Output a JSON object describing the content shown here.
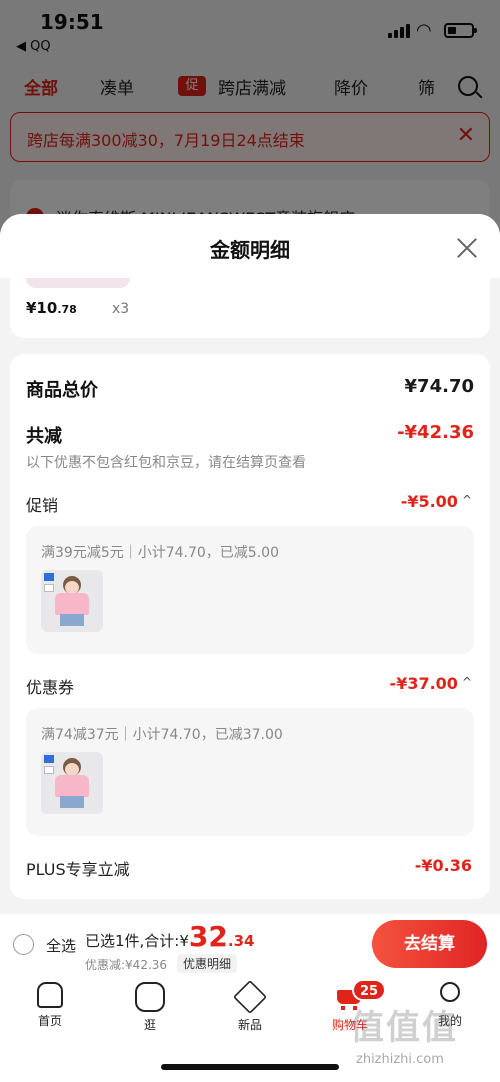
{
  "status": {
    "time": "19:51",
    "back_app": "◀ QQ"
  },
  "tabs": [
    {
      "label": "全部"
    },
    {
      "label": "凑单"
    },
    {
      "label": "跨店满减",
      "tag": "促"
    },
    {
      "label": "降价"
    },
    {
      "label": "筛"
    }
  ],
  "banner": {
    "text": "跨店每满300减30，7月19日24点结束"
  },
  "store": {
    "name": "迷你真维斯 MINI JEANSWEST童装旗舰店"
  },
  "sheet": {
    "title": "金额明细",
    "prev_item": {
      "price_main": "¥10",
      "price_decimal": ".78",
      "qty": "x3"
    },
    "goods_total": {
      "label": "商品总价",
      "value": "¥74.70"
    },
    "total_discount": {
      "label": "共减",
      "value": "-¥42.36",
      "note": "以下优惠不包含红包和京豆，请在结算页查看"
    },
    "promotion": {
      "label": "促销",
      "value": "-¥5.00",
      "caret": "^",
      "detail": "满39元减5元｜小计74.70，已减5.00"
    },
    "coupon": {
      "label": "优惠券",
      "value": "-¥37.00",
      "caret": "^",
      "detail": "满74减37元｜小计74.70，已减37.00"
    },
    "plus": {
      "label": "PLUS专享立减",
      "value": "-¥0.36"
    }
  },
  "checkout": {
    "select_all": "全选",
    "selected_prefix": "已选1件,合计:¥",
    "total_int": "32",
    "total_dec": ".34",
    "discount_line": "优惠减:¥42.36",
    "detail_chip": "优惠明细",
    "button": "去结算"
  },
  "nav": {
    "items": [
      {
        "label": "首页"
      },
      {
        "label": "逛"
      },
      {
        "label": "新品"
      },
      {
        "label": "购物车"
      },
      {
        "label": "我的"
      }
    ],
    "cart_badge": "25"
  },
  "watermark": {
    "main": "值值值",
    "sub": "zhizhizhi.com"
  },
  "colors": {
    "accent": "#e2231a",
    "muted": "#888888"
  }
}
